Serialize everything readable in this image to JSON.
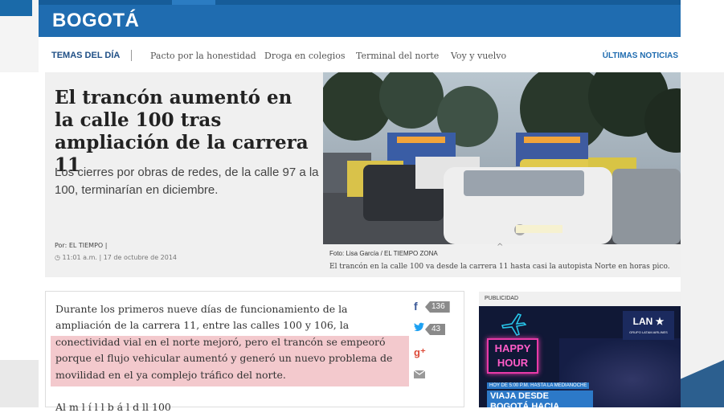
{
  "section": {
    "title": "BOGOTÁ"
  },
  "nav": {
    "label": "TEMAS DEL DÍA",
    "items": [
      "Pacto por la honestidad",
      "Droga en colegios",
      "Terminal del norte",
      "Voy y vuelvo"
    ],
    "latest": "ÚLTIMAS NOTICIAS"
  },
  "article": {
    "headline": "El trancón aumentó en la calle 100 tras ampliación de la carrera 11",
    "dek": "Los cierres por obras de redes, de la calle 97 a la 100, terminarían en diciembre.",
    "byline": "Por: EL TIEMPO |",
    "dateline": "11:01 a.m. | 17 de octubre de 2014",
    "photo_credit": "Foto: Lisa García / EL TIEMPO ZONA",
    "photo_caption": "El trancón en la calle 100 va desde la carrera 11 hasta casi la autopista Norte en horas pico.",
    "body_lines": [
      "Durante los primeros nueve días de funcionamiento de la",
      "ampliación de la carrera 11, entre las calles 100 y 106, la",
      "conectividad vial en el norte mejoró, pero el trancón se empeoró",
      "porque el flujo vehicular aumentó y generó un nuevo problema de",
      "movilidad en el ya complejo tráfico del norte."
    ],
    "body_next": "Al m                                  l   í  l    l       b    á  l      d    ll   100"
  },
  "social": {
    "facebook_count": "136",
    "twitter_count": "43",
    "icons": [
      "facebook-icon",
      "twitter-icon",
      "google-plus-icon",
      "email-icon"
    ]
  },
  "ad": {
    "label": "PUBLICIDAD",
    "brand": "LAN",
    "brand_sub": "GRUPO LATAM AIRLINES",
    "neon_text": "HAPPY HOUR",
    "small_text": "HOY DE 5:00 P.M. HASTA LA MEDIANOCHE",
    "big_text": "VIAJA DESDE BOGOTÁ HACIA MEDELLÍN"
  },
  "colors": {
    "header_blue": "#1f6cb0",
    "nav_label": "#1f4f86",
    "highlight": "#f3c9cd",
    "facebook": "#3b5998",
    "twitter": "#1da1f2",
    "google_plus": "#dd4b39"
  }
}
